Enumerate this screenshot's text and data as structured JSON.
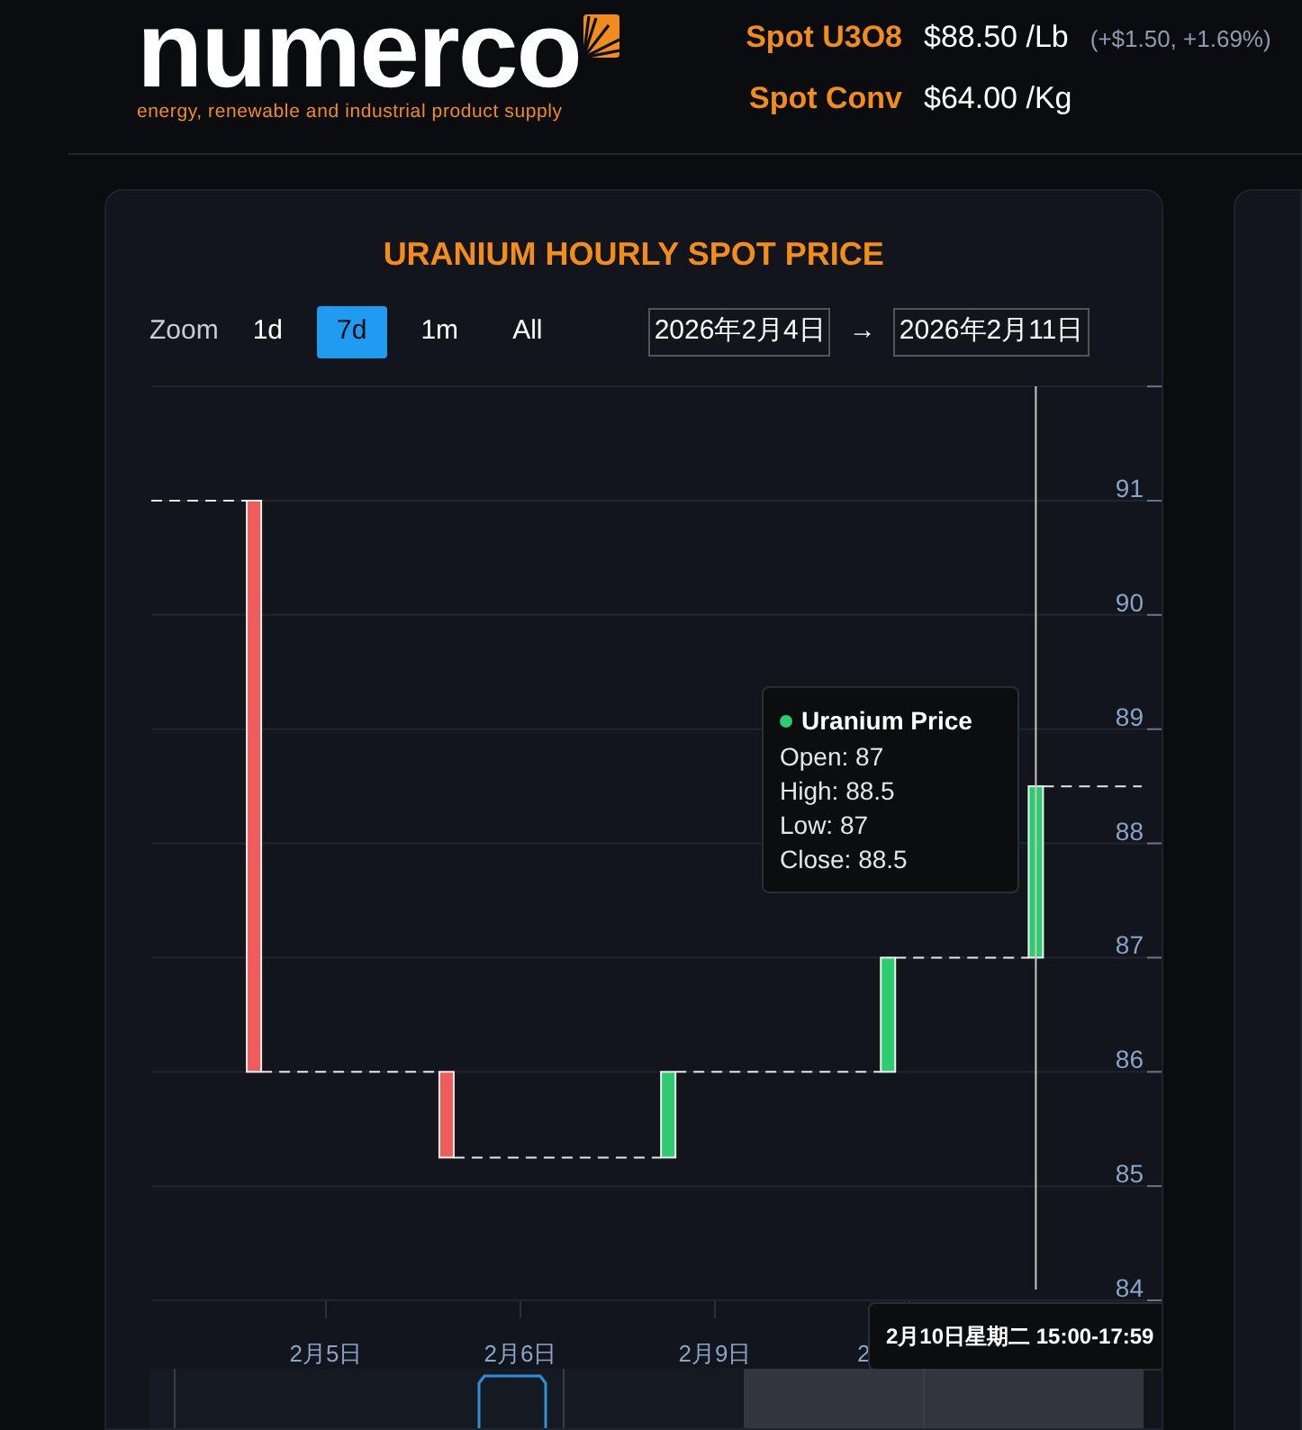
{
  "header": {
    "logo": "numerco",
    "tagline": "energy, renewable and industrial product supply",
    "prices": [
      {
        "label": "Spot U3O8",
        "value": "$88.50 /Lb",
        "change": "(+$1.50, +1.69%)"
      },
      {
        "label": "Spot Conv",
        "value": "$64.00 /Kg"
      }
    ]
  },
  "card": {
    "title": "URANIUM HOURLY SPOT PRICE",
    "zoom_label": "Zoom",
    "zoom_buttons": [
      {
        "label": "1d",
        "selected": false
      },
      {
        "label": "7d",
        "selected": true
      },
      {
        "label": "1m",
        "selected": false
      },
      {
        "label": "All",
        "selected": false
      }
    ],
    "date_from": "2026年2月4日",
    "arrow": "→",
    "date_to": "2026年2月11日",
    "y_axis_labels": [
      "91",
      "90",
      "89",
      "88",
      "87",
      "86",
      "85",
      "84"
    ],
    "x_axis_labels": [
      "2月5日",
      "2月6日",
      "2月9日",
      "2"
    ],
    "tooltip": {
      "title": "Uranium Price",
      "color": "#2ecc71",
      "lines": [
        "Open: 87",
        "High: 88.5",
        "Low: 87",
        "Close: 88.5"
      ]
    },
    "crosshair_label": "2月10日星期二 15:00-17:59"
  }
}
